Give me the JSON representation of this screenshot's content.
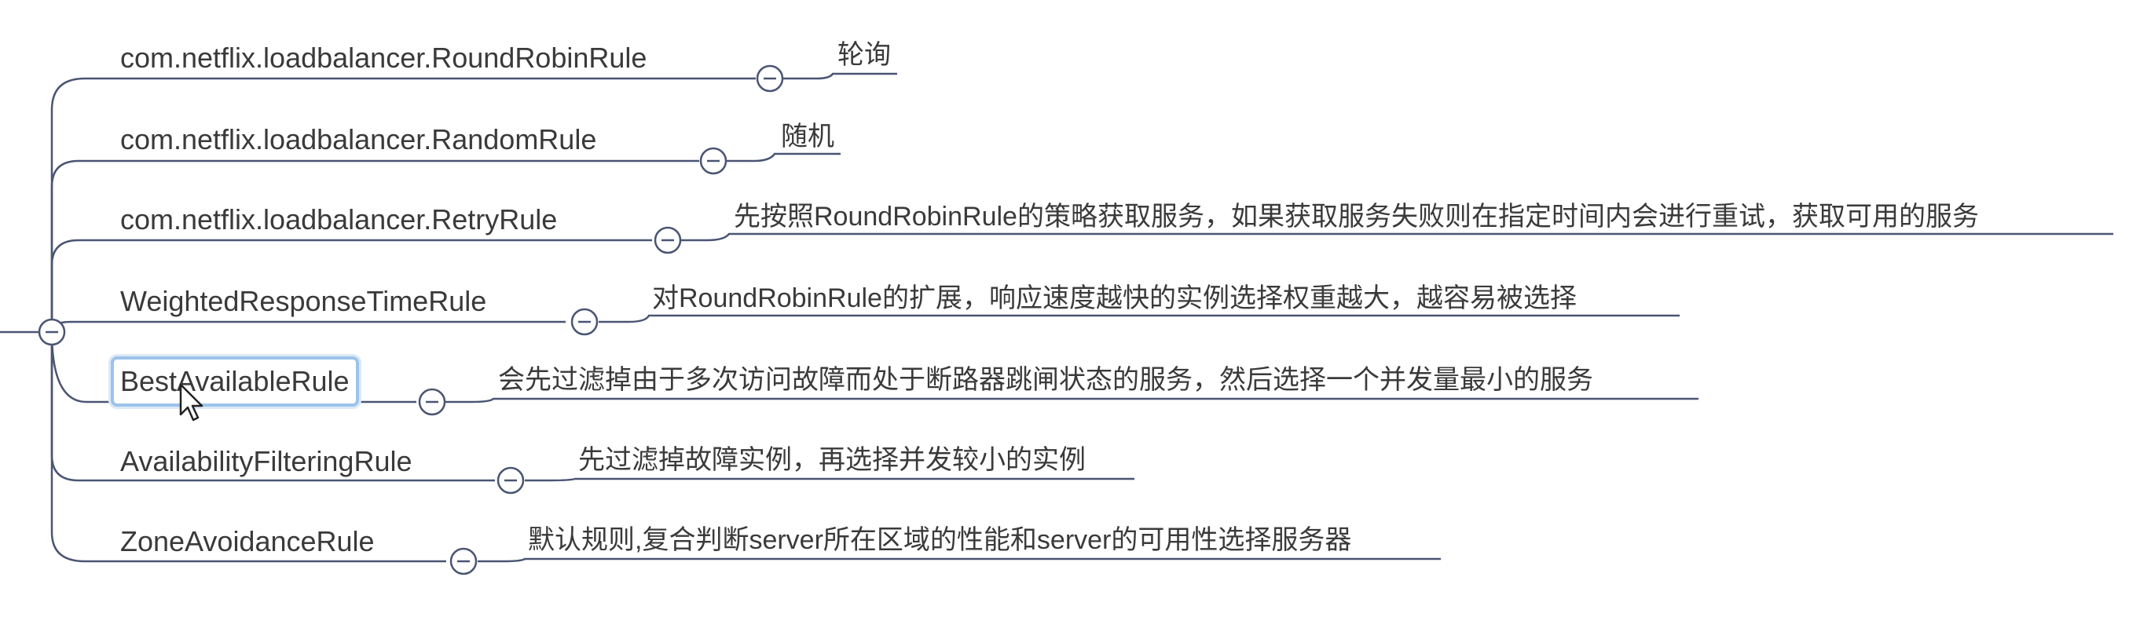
{
  "root": {
    "label": ""
  },
  "branches": [
    {
      "rule": "com.netflix.loadbalancer.RoundRobinRule",
      "note": "轮询"
    },
    {
      "rule": "com.netflix.loadbalancer.RandomRule",
      "note": "随机"
    },
    {
      "rule": "com.netflix.loadbalancer.RetryRule",
      "note": "先按照RoundRobinRule的策略获取服务，如果获取服务失败则在指定时间内会进行重试，获取可用的服务"
    },
    {
      "rule": "WeightedResponseTimeRule",
      "note": "对RoundRobinRule的扩展，响应速度越快的实例选择权重越大，越容易被选择"
    },
    {
      "rule": "BestAvailableRule",
      "note": "会先过滤掉由于多次访问故障而处于断路器跳闸状态的服务，然后选择一个并发量最小的服务",
      "selected": true
    },
    {
      "rule": "AvailabilityFilteringRule",
      "note": "先过滤掉故障实例，再选择并发较小的实例"
    },
    {
      "rule": "ZoneAvoidanceRule",
      "note": "默认规则,复合判断server所在区域的性能和server的可用性选择服务器"
    }
  ],
  "colors": {
    "line": "#4a5573",
    "collapse_button": "#4a5573",
    "selection_border": "#9cc3ea"
  },
  "icons": {
    "collapse": "minus-circle-icon",
    "pointer": "mouse-cursor-icon"
  }
}
